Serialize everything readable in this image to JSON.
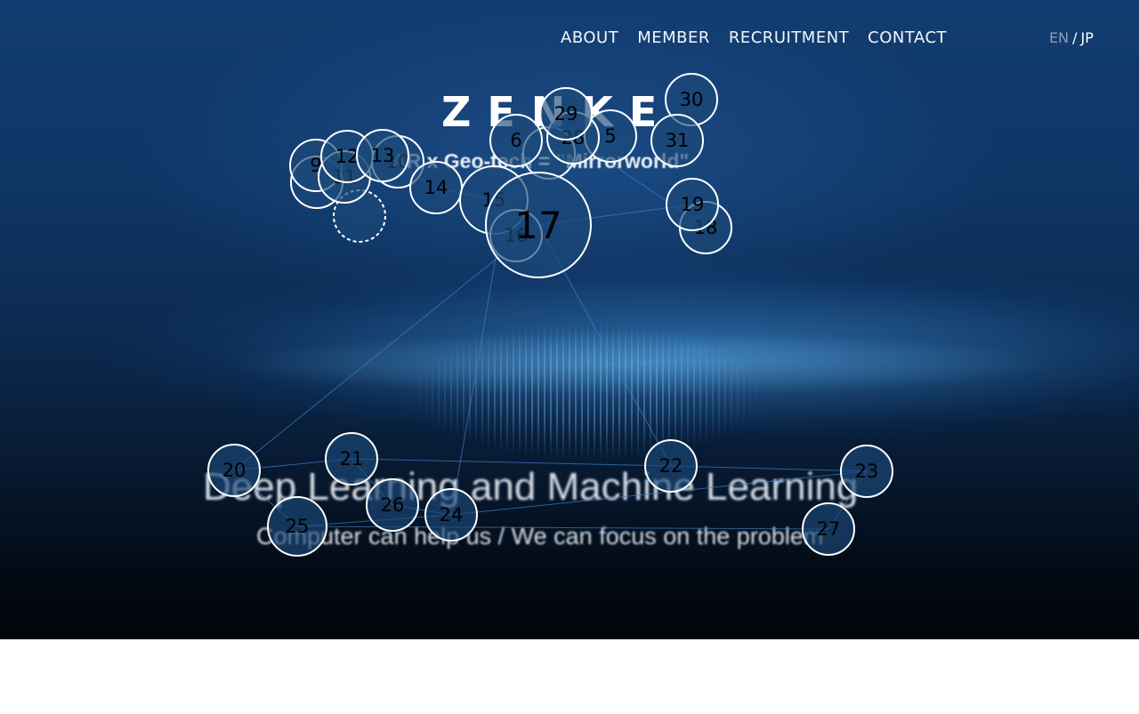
{
  "nav": {
    "items": [
      {
        "id": "about",
        "label": "ABOUT"
      },
      {
        "id": "member",
        "label": "MEMBER"
      },
      {
        "id": "recruitment",
        "label": "RECRUITMENT"
      },
      {
        "id": "contact",
        "label": "CONTACT"
      }
    ],
    "lang_en": "EN",
    "lang_sep": "/",
    "lang_jp": "JP"
  },
  "hero": {
    "brand": "ZENKE",
    "tagline": "AR x Geo-tech = \"Mirrorworld\"",
    "headline": "Deep Learning and Machine Learning",
    "subline": "Computer can help us / We can focus on the problem"
  },
  "bubbles": [
    {
      "id": "5"
    },
    {
      "id": "6"
    },
    {
      "id": "9"
    },
    {
      "id": "10"
    },
    {
      "id": "11"
    },
    {
      "id": "12"
    },
    {
      "id": "13"
    },
    {
      "id": "14"
    },
    {
      "id": "15"
    },
    {
      "id": "16"
    },
    {
      "id": "17"
    },
    {
      "id": "18"
    },
    {
      "id": "19"
    },
    {
      "id": "20"
    },
    {
      "id": "21"
    },
    {
      "id": "22"
    },
    {
      "id": "23"
    },
    {
      "id": "24"
    },
    {
      "id": "25"
    },
    {
      "id": "26"
    },
    {
      "id": "27"
    },
    {
      "id": "28"
    },
    {
      "id": "29"
    },
    {
      "id": "30"
    },
    {
      "id": "31"
    }
  ],
  "colors": {
    "bubble_fill": "#1b4a7a",
    "bubble_stroke": "#ffffff",
    "link": "#3f7fc4",
    "lang_inactive": "#8a9cb2"
  }
}
